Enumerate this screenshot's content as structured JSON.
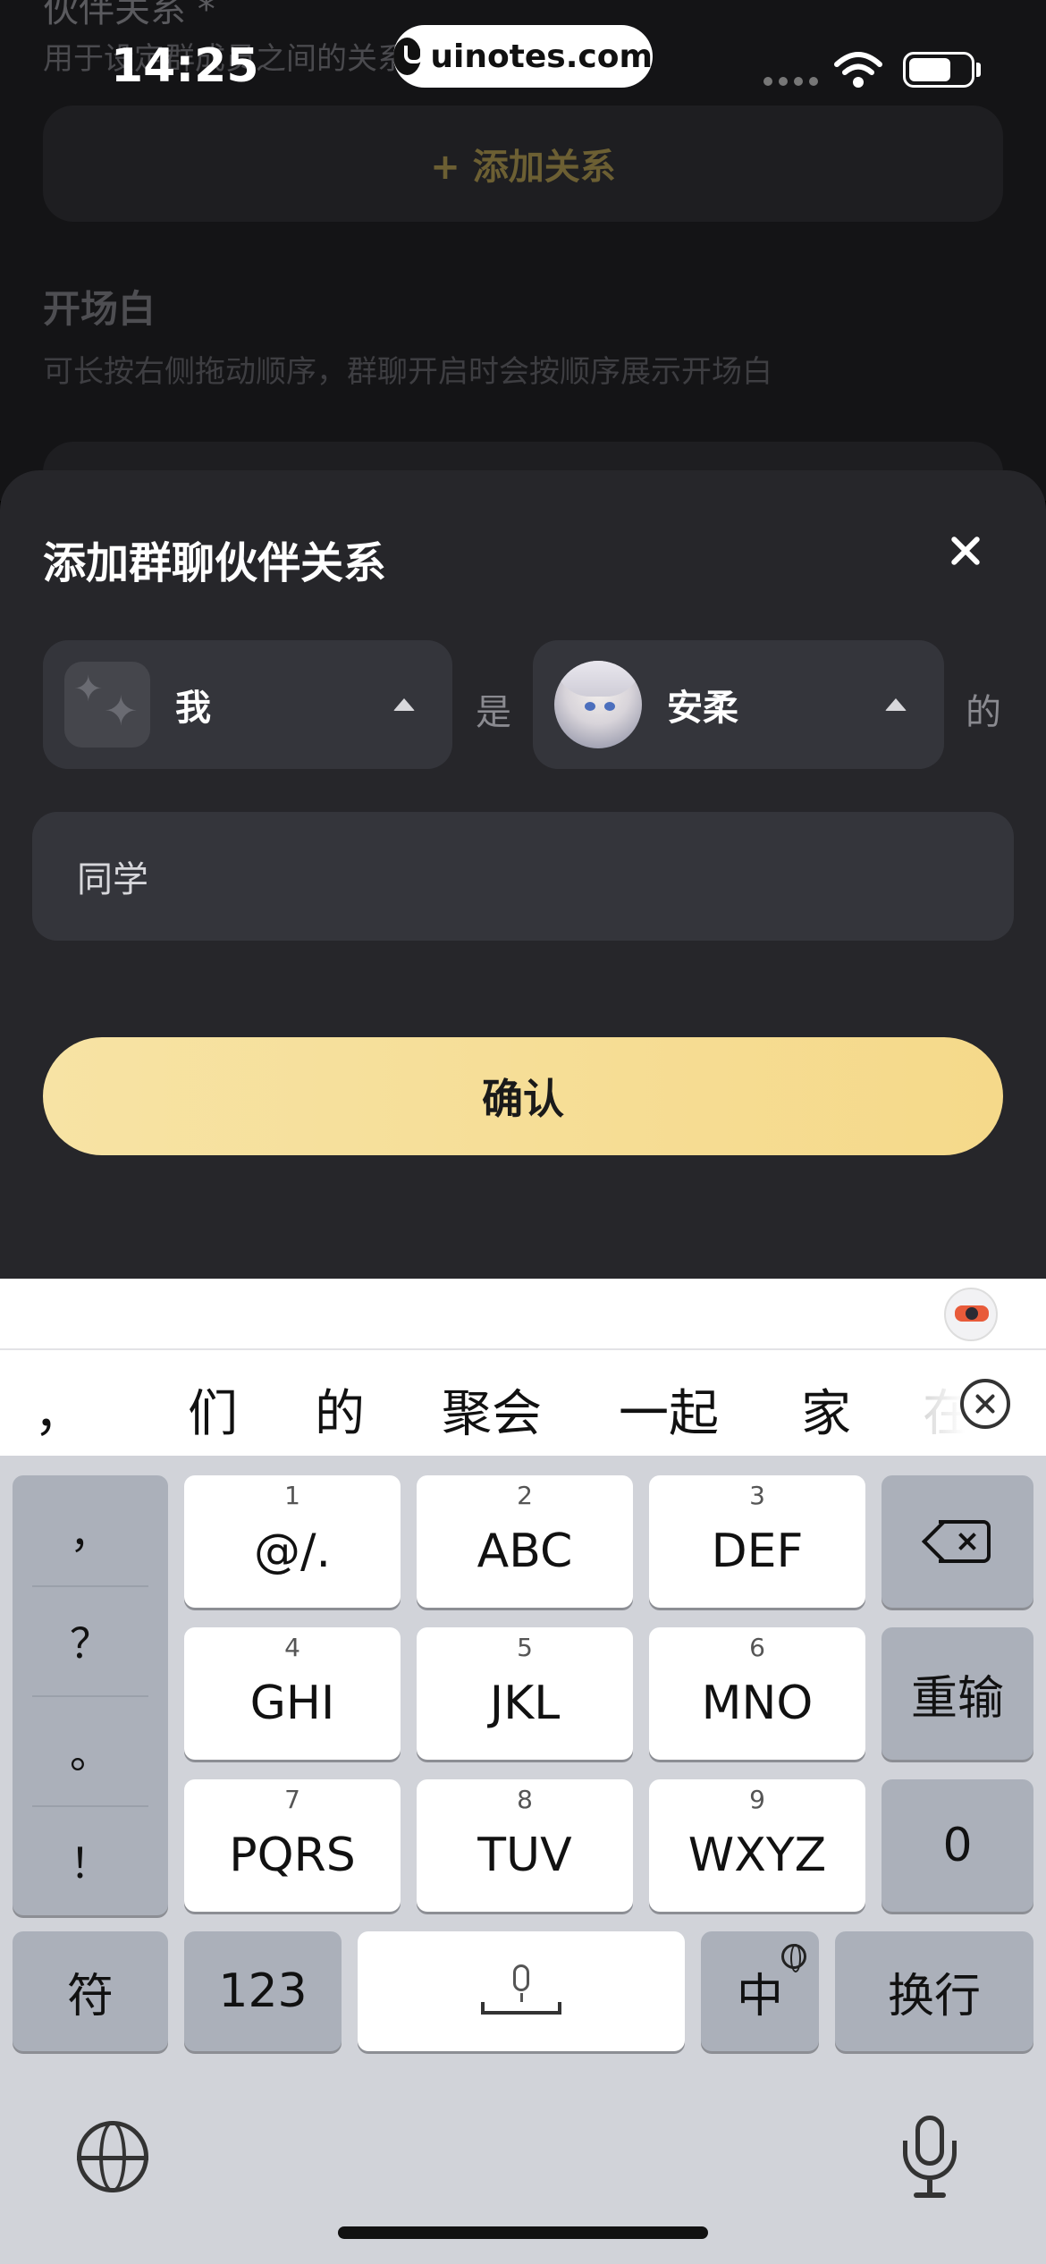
{
  "status_bar": {
    "time": "14:25",
    "url": "uinotes.com"
  },
  "background": {
    "section1_title": "伙伴关系 *",
    "section1_desc": "用于设定群成员之间的关系",
    "add_relation_button": "+ 添加关系",
    "section2_title": "开场白",
    "section2_desc": "可长按右侧拖动顺序，群聊开启时会按顺序展示开场白"
  },
  "sheet": {
    "title": "添加群聊伙伴关系",
    "left_picker": {
      "name": "我",
      "avatar": "sparkle-avatar"
    },
    "connector_is": "是",
    "right_picker": {
      "name": "安柔",
      "avatar": "anime-character-avatar"
    },
    "connector_of": "的",
    "relation_value": "同学",
    "confirm_label": "确认"
  },
  "ime": {
    "candidates": [
      "，",
      "们",
      "的",
      "聚会",
      "一起",
      "家",
      "在"
    ]
  },
  "keyboard": {
    "punctuation": [
      "，",
      "？",
      "。",
      "！"
    ],
    "keys": [
      {
        "num": "1",
        "main": "@/."
      },
      {
        "num": "2",
        "main": "ABC"
      },
      {
        "num": "3",
        "main": "DEF"
      },
      {
        "num": "4",
        "main": "GHI"
      },
      {
        "num": "5",
        "main": "JKL"
      },
      {
        "num": "6",
        "main": "MNO"
      },
      {
        "num": "7",
        "main": "PQRS"
      },
      {
        "num": "8",
        "main": "TUV"
      },
      {
        "num": "9",
        "main": "WXYZ"
      }
    ],
    "retype_label": "重输",
    "zero_label": "0",
    "symbol_label": "符",
    "numbers_label": "123",
    "chinese_label": "中",
    "return_label": "换行"
  },
  "colors": {
    "sheet_bg": "#26262a",
    "confirm_gradient_start": "#f7e3a4",
    "confirm_gradient_end": "#f5d98a",
    "keyboard_bg": "#d1d3d9"
  }
}
